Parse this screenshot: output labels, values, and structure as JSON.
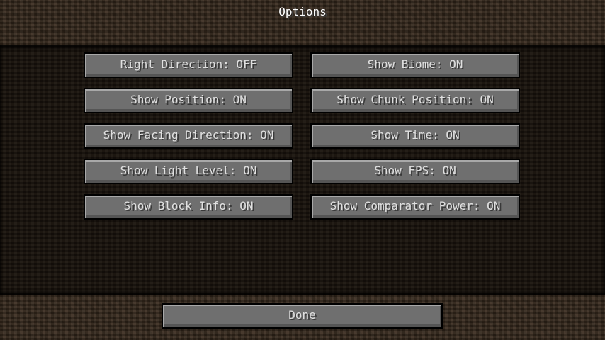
{
  "screen": {
    "title": "Options"
  },
  "options": {
    "left": [
      "Right Direction: OFF",
      "Show Position: ON",
      "Show Facing Direction: ON",
      "Show Light Level: ON",
      "Show Block Info: ON"
    ],
    "right": [
      "Show Biome: ON",
      "Show Chunk Position: ON",
      "Show Time: ON",
      "Show FPS: ON",
      "Show Comparator Power: ON"
    ]
  },
  "footer": {
    "done_label": "Done"
  },
  "colors": {
    "button_face": "#6f6f6f",
    "button_text": "#e0e0e0",
    "title_text": "#ffffff",
    "dirt_light": "#3a2c1f",
    "dirt_dark": "#1c150e"
  }
}
